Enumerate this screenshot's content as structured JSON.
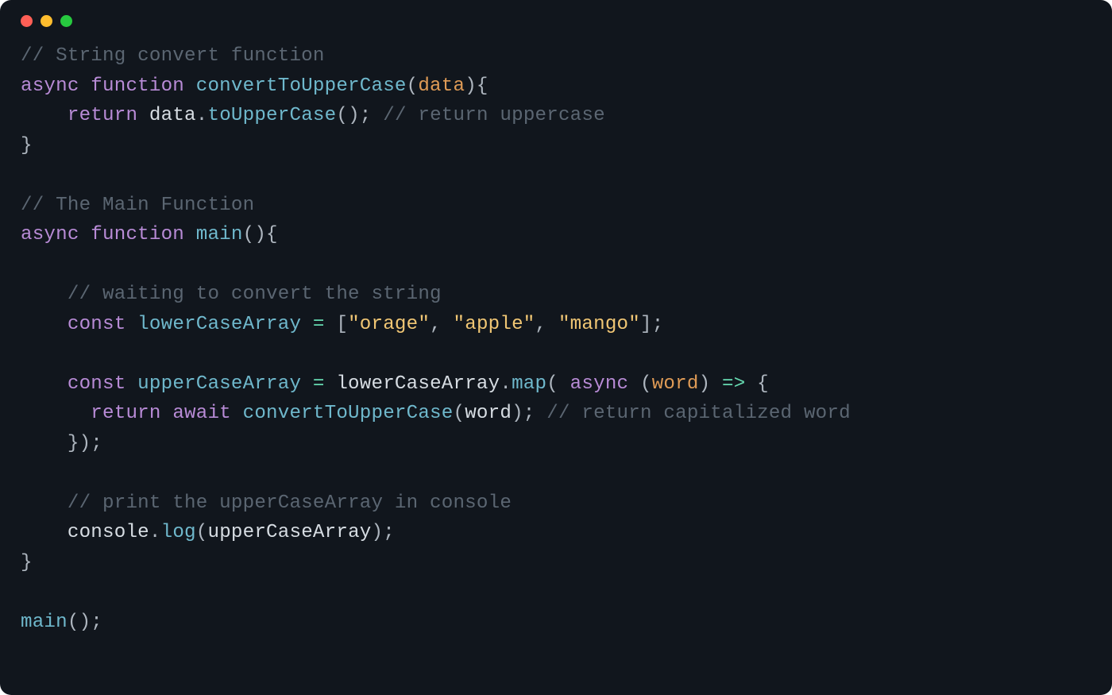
{
  "code": {
    "line1": {
      "comment": "// String convert function"
    },
    "line2": {
      "async": "async",
      "function": "function",
      "fname": "convertToUpperCase",
      "lpar": "(",
      "param": "data",
      "rparBrace": "){"
    },
    "line3": {
      "indent": "    ",
      "return": "return",
      "sp": " ",
      "obj": "data",
      "dot": ".",
      "method": "toUpperCase",
      "call": "();",
      "sp2": " ",
      "comment": "// return uppercase"
    },
    "line4": {
      "brace": "}"
    },
    "line5": {
      "blank": ""
    },
    "line6": {
      "comment": "// The Main Function"
    },
    "line7": {
      "async": "async",
      "function": "function",
      "fname": "main",
      "call": "(){"
    },
    "line8": {
      "blank": ""
    },
    "line9": {
      "indent": "    ",
      "comment": "// waiting to convert the string"
    },
    "line10": {
      "indent": "    ",
      "const": "const",
      "sp": " ",
      "name": "lowerCaseArray",
      "sp2": " ",
      "eq": "=",
      "sp3": " ",
      "lbrack": "[",
      "s1": "\"orage\"",
      "c1": ", ",
      "s2": "\"apple\"",
      "c2": ", ",
      "s3": "\"mango\"",
      "rbrack": "];"
    },
    "line11": {
      "blank": ""
    },
    "line12": {
      "indent": "    ",
      "const": "const",
      "sp": " ",
      "name": "upperCaseArray",
      "sp2": " ",
      "eq": "=",
      "sp3": " ",
      "src": "lowerCaseArray",
      "dot": ".",
      "method": "map",
      "lpar": "( ",
      "async": "async",
      "sp4": " ",
      "lpar2": "(",
      "param": "word",
      "rpar2": ")",
      "sp5": " ",
      "arrow": "=>",
      "sp6": " ",
      "brace": "{"
    },
    "line13": {
      "indent": "      ",
      "return": "return",
      "sp": " ",
      "await": "await",
      "sp2": " ",
      "fname": "convertToUpperCase",
      "lpar": "(",
      "arg": "word",
      "rpar": ");",
      "sp3": " ",
      "comment": "// return capitalized word"
    },
    "line14": {
      "indent": "    ",
      "close": "});"
    },
    "line15": {
      "blank": ""
    },
    "line16": {
      "indent": "    ",
      "comment": "// print the upperCaseArray in console"
    },
    "line17": {
      "indent": "    ",
      "obj": "console",
      "dot": ".",
      "method": "log",
      "lpar": "(",
      "arg": "upperCaseArray",
      "rpar": ");"
    },
    "line18": {
      "brace": "}"
    },
    "line19": {
      "blank": ""
    },
    "line20": {
      "fname": "main",
      "call": "();"
    }
  }
}
